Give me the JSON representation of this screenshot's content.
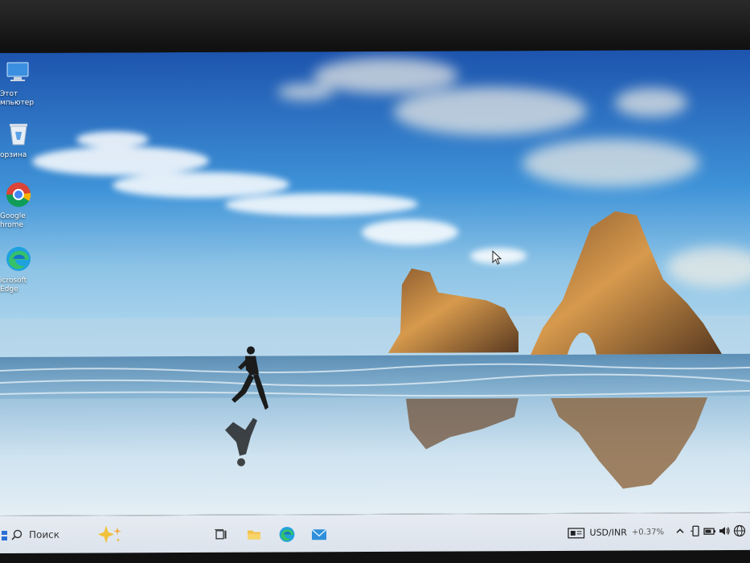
{
  "desktop": {
    "icons": [
      {
        "label": "Этот\nмпьютер",
        "icon": "computer-icon"
      },
      {
        "label": "орзина",
        "icon": "recycle-bin-icon"
      },
      {
        "label": "Google\nhrome",
        "icon": "chrome-icon"
      },
      {
        "label": "icrosoft\nEdge",
        "icon": "edge-icon"
      }
    ]
  },
  "taskbar": {
    "search_placeholder": "Поиск",
    "apps": [
      "copilot-icon",
      "task-view-icon",
      "file-explorer-icon",
      "edge-icon",
      "mail-icon"
    ],
    "widget": {
      "label": "USD/INR",
      "change": "+0.37%"
    },
    "tray_icons": [
      "chevron-up-icon",
      "phone-link-icon",
      "battery-icon",
      "volume-icon",
      "globe-icon"
    ]
  },
  "colors": {
    "sky_top": "#1f5fb8",
    "sea": "#6fa6c8",
    "sand": "#c9dcea",
    "taskbar": "#e3e9f1",
    "accent": "#1677d8"
  }
}
